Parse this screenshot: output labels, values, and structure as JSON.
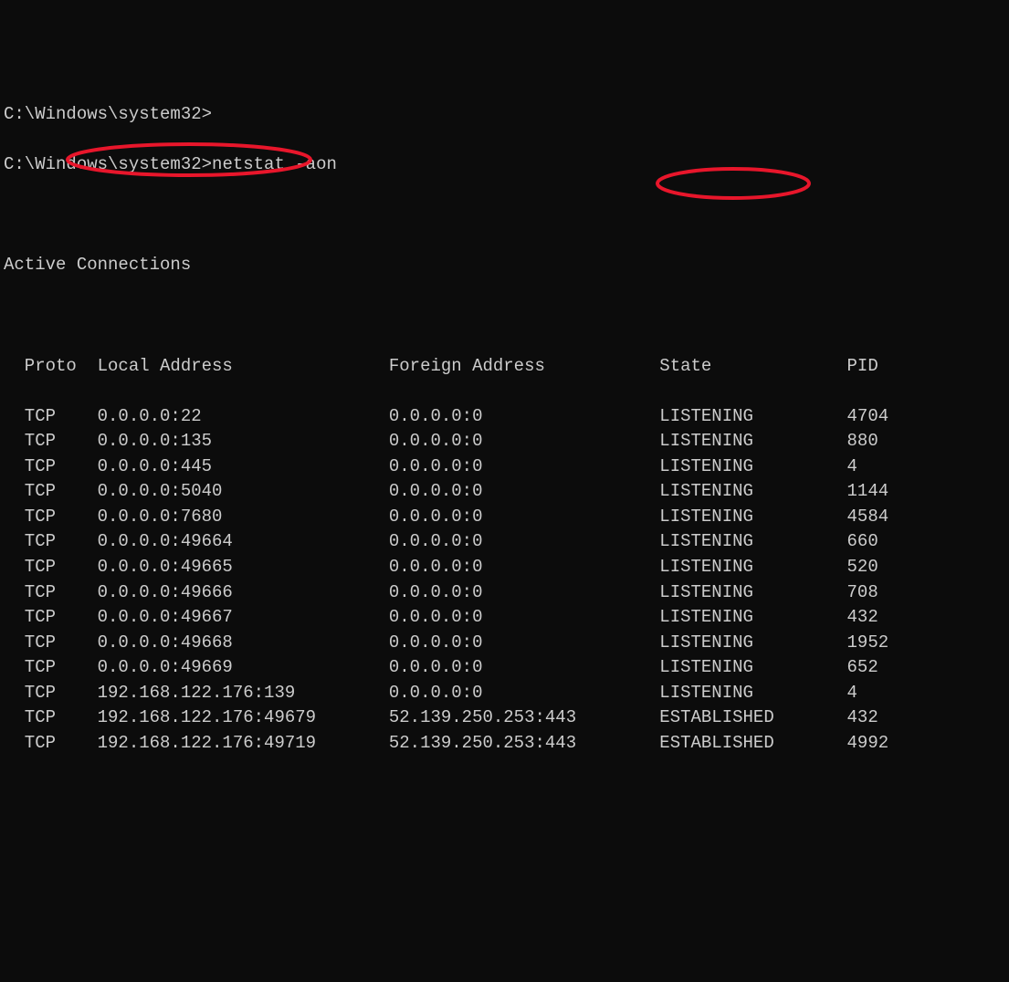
{
  "prompts": [
    {
      "path": "C:\\Windows\\system32>",
      "command": ""
    },
    {
      "path": "C:\\Windows\\system32>",
      "command": "netstat -aon"
    }
  ],
  "section_title": "Active Connections",
  "headers": {
    "proto": "Proto",
    "local": "Local Address",
    "foreign": "Foreign Address",
    "state": "State",
    "pid": "PID"
  },
  "rows": [
    {
      "proto": "TCP",
      "local": "0.0.0.0:22",
      "foreign": "0.0.0.0:0",
      "state": "LISTENING",
      "pid": "4704"
    },
    {
      "proto": "TCP",
      "local": "0.0.0.0:135",
      "foreign": "0.0.0.0:0",
      "state": "LISTENING",
      "pid": "880"
    },
    {
      "proto": "TCP",
      "local": "0.0.0.0:445",
      "foreign": "0.0.0.0:0",
      "state": "LISTENING",
      "pid": "4"
    },
    {
      "proto": "TCP",
      "local": "0.0.0.0:5040",
      "foreign": "0.0.0.0:0",
      "state": "LISTENING",
      "pid": "1144"
    },
    {
      "proto": "TCP",
      "local": "0.0.0.0:7680",
      "foreign": "0.0.0.0:0",
      "state": "LISTENING",
      "pid": "4584"
    },
    {
      "proto": "TCP",
      "local": "0.0.0.0:49664",
      "foreign": "0.0.0.0:0",
      "state": "LISTENING",
      "pid": "660"
    },
    {
      "proto": "TCP",
      "local": "0.0.0.0:49665",
      "foreign": "0.0.0.0:0",
      "state": "LISTENING",
      "pid": "520"
    },
    {
      "proto": "TCP",
      "local": "0.0.0.0:49666",
      "foreign": "0.0.0.0:0",
      "state": "LISTENING",
      "pid": "708"
    },
    {
      "proto": "TCP",
      "local": "0.0.0.0:49667",
      "foreign": "0.0.0.0:0",
      "state": "LISTENING",
      "pid": "432"
    },
    {
      "proto": "TCP",
      "local": "0.0.0.0:49668",
      "foreign": "0.0.0.0:0",
      "state": "LISTENING",
      "pid": "1952"
    },
    {
      "proto": "TCP",
      "local": "0.0.0.0:49669",
      "foreign": "0.0.0.0:0",
      "state": "LISTENING",
      "pid": "652"
    },
    {
      "proto": "TCP",
      "local": "192.168.122.176:139",
      "foreign": "0.0.0.0:0",
      "state": "LISTENING",
      "pid": "4"
    },
    {
      "proto": "TCP",
      "local": "192.168.122.176:49679",
      "foreign": "52.139.250.253:443",
      "state": "ESTABLISHED",
      "pid": "432"
    },
    {
      "proto": "TCP",
      "local": "192.168.122.176:49719",
      "foreign": "52.139.250.253:443",
      "state": "ESTABLISHED",
      "pid": "4992"
    }
  ],
  "annotations": {
    "circle_color": "#e8162b"
  }
}
